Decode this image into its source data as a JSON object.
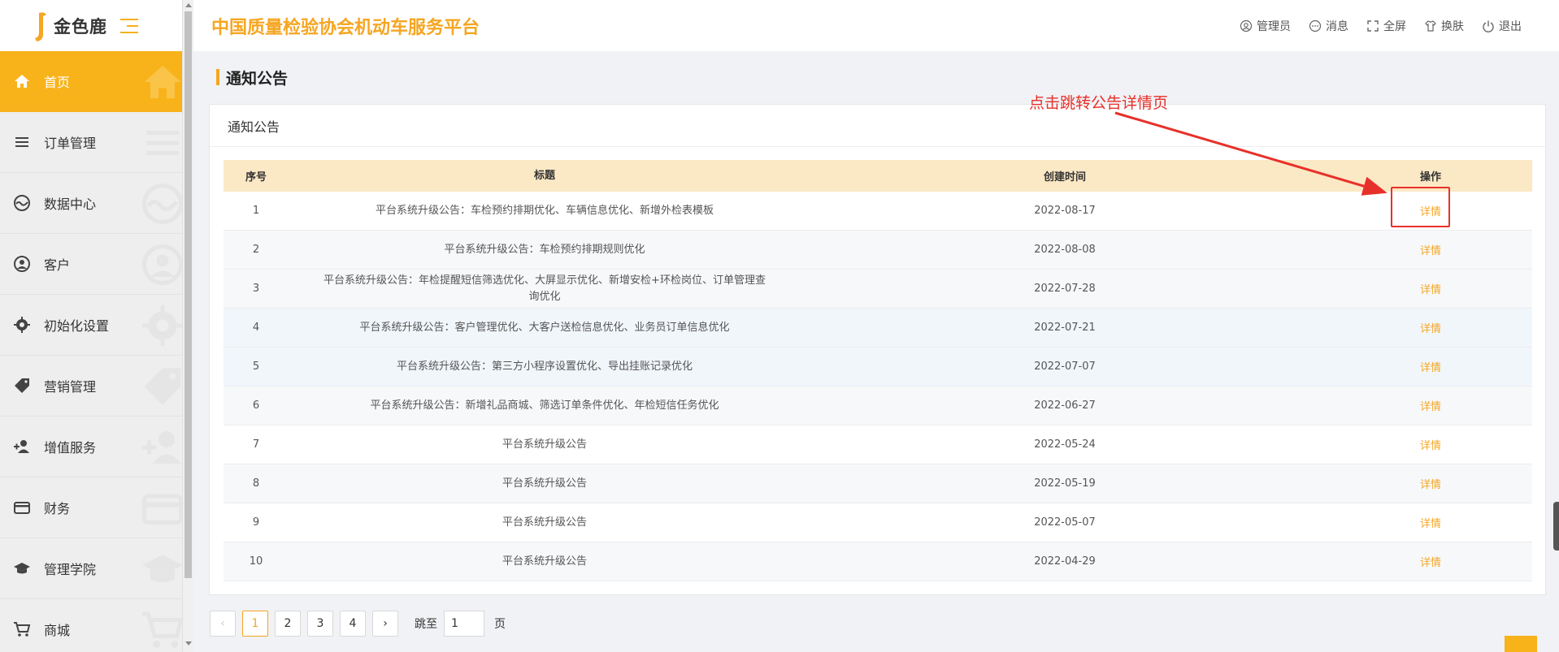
{
  "app": {
    "logo_text": "金色鹿",
    "title": "中国质量检验协会机动车服务平台"
  },
  "header": {
    "actions": [
      {
        "label": "管理员",
        "icon": "user-circle-icon"
      },
      {
        "label": "消息",
        "icon": "message-icon"
      },
      {
        "label": "全屏",
        "icon": "fullscreen-icon"
      },
      {
        "label": "换肤",
        "icon": "skin-icon"
      },
      {
        "label": "退出",
        "icon": "power-icon"
      }
    ]
  },
  "sidebar": {
    "items": [
      {
        "label": "首页",
        "icon": "home-icon",
        "active": true
      },
      {
        "label": "订单管理",
        "icon": "list-icon"
      },
      {
        "label": "数据中心",
        "icon": "chart-icon"
      },
      {
        "label": "客户",
        "icon": "user-icon"
      },
      {
        "label": "初始化设置",
        "icon": "gear-icon"
      },
      {
        "label": "营销管理",
        "icon": "tag-icon"
      },
      {
        "label": "增值服务",
        "icon": "add-user-icon"
      },
      {
        "label": "财务",
        "icon": "card-icon"
      },
      {
        "label": "管理学院",
        "icon": "graduation-icon"
      },
      {
        "label": "商城",
        "icon": "cart-icon"
      }
    ]
  },
  "page": {
    "title": "通知公告",
    "card_title": "通知公告",
    "annotation": "点击跳转公告详情页"
  },
  "table": {
    "headers": [
      "序号",
      "标题",
      "创建时间",
      "操作"
    ],
    "rows": [
      {
        "no": "1",
        "title": "平台系统升级公告：车检预约排期优化、车辆信息优化、新增外检表模板",
        "date": "2022-08-17",
        "action": "详情"
      },
      {
        "no": "2",
        "title": "平台系统升级公告：车检预约排期规则优化",
        "date": "2022-08-08",
        "action": "详情"
      },
      {
        "no": "3",
        "title": "平台系统升级公告：年检提醒短信筛选优化、大屏显示优化、新增安检+环检岗位、订单管理查询优化",
        "date": "2022-07-28",
        "action": "详情"
      },
      {
        "no": "4",
        "title": "平台系统升级公告：客户管理优化、大客户送检信息优化、业务员订单信息优化",
        "date": "2022-07-21",
        "action": "详情"
      },
      {
        "no": "5",
        "title": "平台系统升级公告：第三方小程序设置优化、导出挂账记录优化",
        "date": "2022-07-07",
        "action": "详情"
      },
      {
        "no": "6",
        "title": "平台系统升级公告：新增礼品商城、筛选订单条件优化、年检短信任务优化",
        "date": "2022-06-27",
        "action": "详情"
      },
      {
        "no": "7",
        "title": "平台系统升级公告",
        "date": "2022-05-24",
        "action": "详情"
      },
      {
        "no": "8",
        "title": "平台系统升级公告",
        "date": "2022-05-19",
        "action": "详情"
      },
      {
        "no": "9",
        "title": "平台系统升级公告",
        "date": "2022-05-07",
        "action": "详情"
      },
      {
        "no": "10",
        "title": "平台系统升级公告",
        "date": "2022-04-29",
        "action": "详情"
      }
    ]
  },
  "pagination": {
    "prev": "‹",
    "pages": [
      "1",
      "2",
      "3",
      "4"
    ],
    "current": "1",
    "next": "›",
    "jump_label": "跳至",
    "jump_value": "1",
    "page_label": "页"
  },
  "colors": {
    "accent": "#f5a623",
    "sidebar_active": "#f8b31b",
    "table_header": "#fbe8c5",
    "annotation": "#e8302a"
  }
}
